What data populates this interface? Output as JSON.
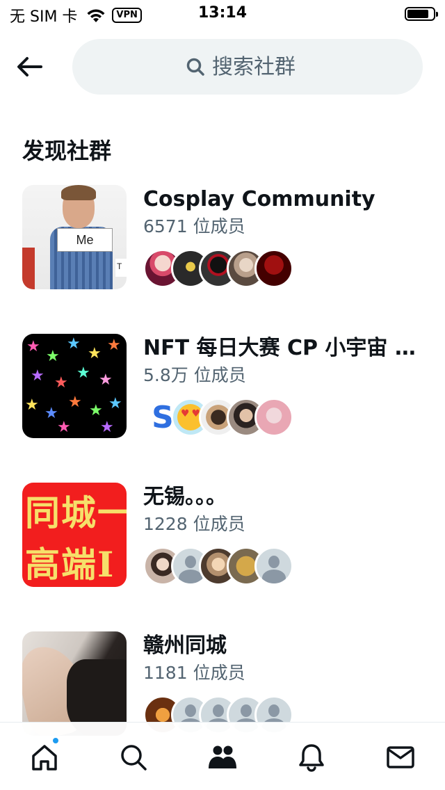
{
  "status_bar": {
    "carrier": "无 SIM 卡",
    "vpn": "VPN",
    "time": "13:14"
  },
  "header": {
    "back_icon": "arrow-left-icon",
    "search_placeholder": "搜索社群"
  },
  "section_title": "发现社群",
  "communities": [
    {
      "name": "Cosplay Community",
      "members": "6571 位成员",
      "thumb_label": "Me",
      "thumb_label2": "T"
    },
    {
      "name": "NFT 每日大赛 CP 小宇宙 B...",
      "members": "5.8万 位成员",
      "avatar_letter": "S"
    },
    {
      "name": "无锡。。。",
      "members": "1228 位成员",
      "thumb_text_line1": "同城一",
      "thumb_text_line2": "高端I"
    },
    {
      "name": "赣州同城",
      "members": "1181 位成员"
    }
  ],
  "tab_bar": {
    "tabs": [
      "home-icon",
      "search-icon",
      "communities-icon",
      "notifications-icon",
      "messages-icon"
    ],
    "accent": "#1d9bf0"
  },
  "colors": {
    "text_primary": "#0f1419",
    "text_secondary": "#536471",
    "search_bg": "#eff3f4"
  }
}
